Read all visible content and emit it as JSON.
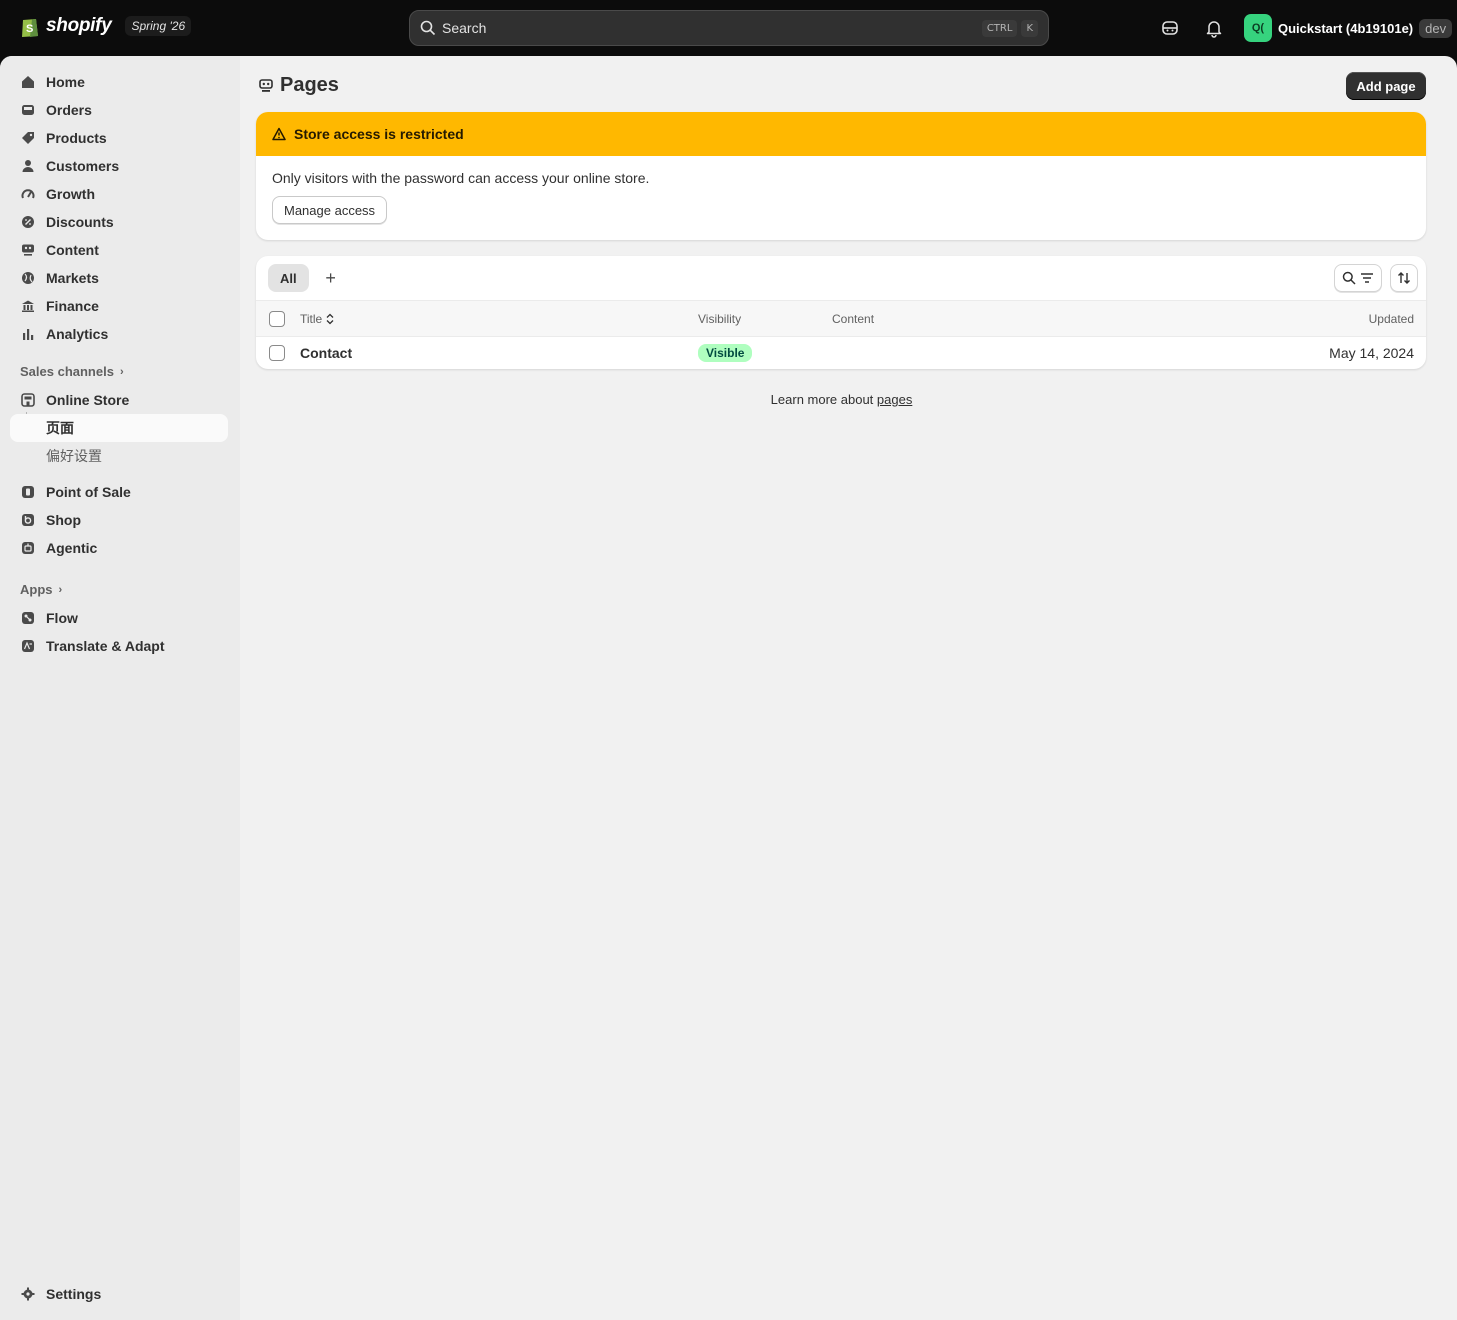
{
  "topbar": {
    "brand": "shopify",
    "edition": "Spring '26",
    "search_placeholder": "Search",
    "shortcut_keys": [
      "CTRL",
      "K"
    ],
    "store_avatar": "Q(",
    "store_name": "Quickstart (4b19101e)",
    "store_tag": "dev"
  },
  "sidebar": {
    "main_items": [
      {
        "label": "Home",
        "icon": "home-icon"
      },
      {
        "label": "Orders",
        "icon": "inbox-icon"
      },
      {
        "label": "Products",
        "icon": "tag-icon"
      },
      {
        "label": "Customers",
        "icon": "person-icon"
      },
      {
        "label": "Growth",
        "icon": "gauge-icon"
      },
      {
        "label": "Discounts",
        "icon": "discount-icon"
      },
      {
        "label": "Content",
        "icon": "content-icon"
      },
      {
        "label": "Markets",
        "icon": "globe-icon"
      },
      {
        "label": "Finance",
        "icon": "bank-icon"
      },
      {
        "label": "Analytics",
        "icon": "bar-chart-icon"
      }
    ],
    "sales_channels_heading": "Sales channels",
    "online_store": "Online Store",
    "sub_items": [
      "页面",
      "偏好设置"
    ],
    "channels": [
      "Point of Sale",
      "Shop",
      "Agentic"
    ],
    "apps_heading": "Apps",
    "apps": [
      "Flow",
      "Translate & Adapt"
    ],
    "settings": "Settings"
  },
  "main": {
    "title": "Pages",
    "add_button": "Add page",
    "banner": {
      "title": "Store access is restricted",
      "text": "Only visitors with the password can access your online store.",
      "button": "Manage access"
    },
    "tabs": [
      "All"
    ],
    "columns": [
      "Title",
      "Visibility",
      "Content",
      "Updated"
    ],
    "rows": [
      {
        "title": "Contact",
        "visibility": "Visible",
        "content": "",
        "updated": "May 14, 2024"
      }
    ],
    "footer_text": "Learn more about ",
    "footer_link": "pages"
  },
  "colors": {
    "banner_warning": "#ffb800",
    "badge_success_bg": "#affebf",
    "primary_button": "#303030",
    "store_avatar": "#36d37e"
  }
}
